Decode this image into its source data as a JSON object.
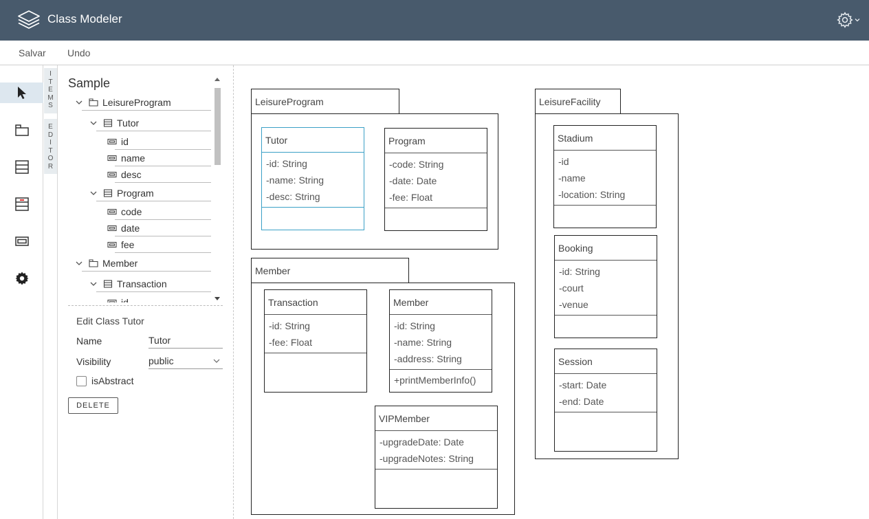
{
  "app": {
    "title": "Class Modeler"
  },
  "toolbar": {
    "save_label": "Salvar",
    "undo_label": "Undo"
  },
  "side_tabs": {
    "items": "ITEMS",
    "editor": "EDITOR"
  },
  "tree": {
    "title": "Sample",
    "rows": [
      {
        "label": "LeisureProgram",
        "kind": "package",
        "depth": 0,
        "expanded": true
      },
      {
        "label": "Tutor",
        "kind": "class",
        "depth": 1,
        "expanded": true
      },
      {
        "label": "id",
        "kind": "attribute",
        "depth": 2
      },
      {
        "label": "name",
        "kind": "attribute",
        "depth": 2
      },
      {
        "label": "desc",
        "kind": "attribute",
        "depth": 2
      },
      {
        "label": "Program",
        "kind": "class",
        "depth": 1,
        "expanded": true
      },
      {
        "label": "code",
        "kind": "attribute",
        "depth": 2
      },
      {
        "label": "date",
        "kind": "attribute",
        "depth": 2
      },
      {
        "label": "fee",
        "kind": "attribute",
        "depth": 2
      },
      {
        "label": "Member",
        "kind": "package",
        "depth": 0,
        "expanded": true
      },
      {
        "label": "Transaction",
        "kind": "class",
        "depth": 1,
        "expanded": true
      },
      {
        "label": "id",
        "kind": "attribute",
        "depth": 2
      }
    ]
  },
  "editor": {
    "title": "Edit Class Tutor",
    "name_label": "Name",
    "name_value": "Tutor",
    "visibility_label": "Visibility",
    "visibility_value": "public",
    "abstract_label": "isAbstract",
    "abstract_checked": false,
    "delete_label": "DELETE"
  },
  "diagram": {
    "packages": [
      {
        "name": "LeisureProgram"
      },
      {
        "name": "Member"
      },
      {
        "name": "LeisureFacility"
      }
    ],
    "classes": [
      {
        "name": "Tutor",
        "package": "LeisureProgram",
        "selected": true,
        "attributes": [
          "-id: String",
          "-name: String",
          "-desc: String"
        ],
        "operations": []
      },
      {
        "name": "Program",
        "package": "LeisureProgram",
        "attributes": [
          "-code: String",
          "-date: Date",
          "-fee: Float"
        ],
        "operations": []
      },
      {
        "name": "Transaction",
        "package": "Member",
        "attributes": [
          "-id: String",
          "-fee: Float"
        ],
        "operations": []
      },
      {
        "name": "Member",
        "package": "Member",
        "attributes": [
          "-id: String",
          "-name: String",
          "-address: String"
        ],
        "operations": [
          "+printMemberInfo()"
        ]
      },
      {
        "name": "VIPMember",
        "package": "Member",
        "attributes": [
          "-upgradeDate: Date",
          "-upgradeNotes: String"
        ],
        "operations": []
      },
      {
        "name": "Stadium",
        "package": "LeisureFacility",
        "attributes": [
          "-id",
          "-name",
          "-location: String"
        ],
        "operations": []
      },
      {
        "name": "Booking",
        "package": "LeisureFacility",
        "attributes": [
          "-id: String",
          "-court",
          "-venue"
        ],
        "operations": []
      },
      {
        "name": "Session",
        "package": "LeisureFacility",
        "attributes": [
          "-start: Date",
          "-end: Date"
        ],
        "operations": []
      }
    ]
  },
  "colors": {
    "header_bg": "#485a6c",
    "selection": "#3aa0c6",
    "rail_active": "#dde7ef"
  }
}
